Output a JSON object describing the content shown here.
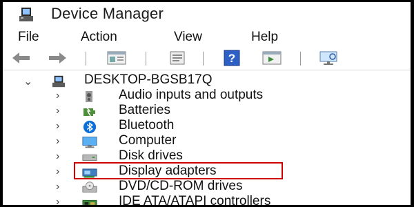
{
  "window": {
    "title": "Device Manager"
  },
  "menu": {
    "items": [
      "File",
      "Action",
      "View",
      "Help"
    ]
  },
  "toolbar": {
    "buttons": [
      "back-arrow-icon",
      "forward-arrow-icon",
      "properties-icon",
      "print-icon",
      "help-icon",
      "update-driver-icon",
      "scan-hardware-icon"
    ]
  },
  "tree": {
    "root": "DESKTOP-BGSB17Q",
    "children": [
      {
        "label": "Audio inputs and outputs",
        "icon": "speaker-icon"
      },
      {
        "label": "Batteries",
        "icon": "battery-icon"
      },
      {
        "label": "Bluetooth",
        "icon": "bluetooth-icon"
      },
      {
        "label": "Computer",
        "icon": "monitor-icon"
      },
      {
        "label": "Disk drives",
        "icon": "disk-drive-icon"
      },
      {
        "label": "Display adapters",
        "icon": "display-adapter-icon",
        "highlighted": true
      },
      {
        "label": "DVD/CD-ROM drives",
        "icon": "dvd-drive-icon"
      },
      {
        "label": "IDE ATA/ATAPI controllers",
        "icon": "ide-controller-icon"
      }
    ]
  },
  "colors": {
    "highlight_border": "#d00000",
    "bluetooth": "#0a6fd6"
  }
}
